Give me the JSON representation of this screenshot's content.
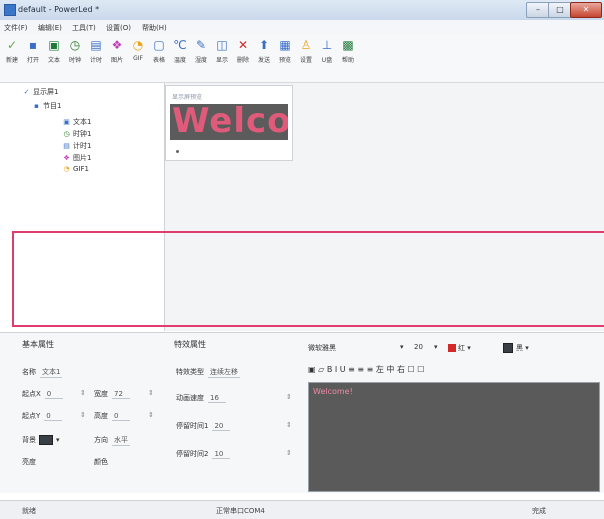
{
  "window": {
    "title": "default - PowerLed *"
  },
  "menubar": {
    "items": [
      "文件(F)",
      "编辑(E)",
      "工具(T)",
      "设置(O)",
      "帮助(H)"
    ]
  },
  "toolbar": {
    "buttons": [
      {
        "label": "新建",
        "icon": "new-icon",
        "glyph": "✓",
        "color": "#6aa84f"
      },
      {
        "label": "打开",
        "icon": "open-icon",
        "glyph": "▪",
        "color": "#3b6fc7"
      },
      {
        "label": "文本",
        "icon": "text-icon",
        "glyph": "▣",
        "color": "#1f7a3a"
      },
      {
        "label": "时钟",
        "icon": "clock-icon",
        "glyph": "◷",
        "color": "#2a7d2a"
      },
      {
        "label": "计时",
        "icon": "timer-icon",
        "glyph": "▤",
        "color": "#3b6fc7"
      },
      {
        "label": "图片",
        "icon": "image-icon",
        "glyph": "❖",
        "color": "#c03db8"
      },
      {
        "label": "GIF",
        "icon": "gif-icon",
        "glyph": "◔",
        "color": "#e8a317"
      },
      {
        "label": "表格",
        "icon": "table-icon",
        "glyph": "▢",
        "color": "#3b6fc7"
      },
      {
        "label": "温度",
        "icon": "temperature-icon",
        "glyph": "℃",
        "color": "#3b6fc7"
      },
      {
        "label": "湿度",
        "icon": "humidity-icon",
        "glyph": "✎",
        "color": "#3b6fc7"
      },
      {
        "label": "显示",
        "icon": "display-icon",
        "glyph": "◫",
        "color": "#3b6fc7"
      },
      {
        "label": "删除",
        "icon": "delete-icon",
        "glyph": "✕",
        "color": "#d22a2a"
      },
      {
        "label": "发送",
        "icon": "send-icon",
        "glyph": "⬆",
        "color": "#3b6fc7"
      },
      {
        "label": "预览",
        "icon": "preview-icon",
        "glyph": "▦",
        "color": "#3b6fc7"
      },
      {
        "label": "设置",
        "icon": "settings-icon",
        "glyph": "♙",
        "color": "#e8a317"
      },
      {
        "label": "U盘",
        "icon": "usb-icon",
        "glyph": "⊥",
        "color": "#3b6fc7"
      },
      {
        "label": "帮助",
        "icon": "help-icon",
        "glyph": "▩",
        "color": "#1f7a3a"
      }
    ]
  },
  "tree": {
    "nodes": [
      {
        "label": "显示屏1",
        "icon": "screen-icon",
        "glyph": "✓",
        "color": "#3b6fc7"
      },
      {
        "label": "节目1",
        "icon": "program-icon",
        "glyph": "▪",
        "color": "#3b6fc7"
      },
      {
        "label": "文本1",
        "icon": "text-icon",
        "glyph": "▣",
        "color": "#3b6fc7"
      },
      {
        "label": "时钟1",
        "icon": "clock-icon",
        "glyph": "◷",
        "color": "#2a7d2a"
      },
      {
        "label": "计时1",
        "icon": "timer-icon",
        "glyph": "▤",
        "color": "#3b6fc7"
      },
      {
        "label": "图片1",
        "icon": "image-icon",
        "glyph": "❖",
        "color": "#c03db8"
      },
      {
        "label": "GIF1",
        "icon": "gif-icon",
        "glyph": "◔",
        "color": "#e8a317"
      }
    ]
  },
  "preview": {
    "caption": "显示屏预览",
    "text": "Welcome!"
  },
  "props": {
    "basic_title": "基本属性",
    "effect_title": "特效属性",
    "name_label": "名称",
    "name_value": "文本1",
    "x_label": "起点X",
    "x_value": "0",
    "w_label": "宽度",
    "w_value": "72",
    "y_label": "起点Y",
    "y_value": "0",
    "h_label": "高度",
    "h_value": "0",
    "bg_label": "背景",
    "dir_label": "方向",
    "dir_value": "水平",
    "brightness_label": "亮度",
    "color_label": "颜色",
    "effect_label": "特效类型",
    "effect_value": "连续左移",
    "speed_label": "动画速度",
    "speed_value": "16",
    "stay_label": "停留时间1",
    "stay_value": "20",
    "stay2_label": "停留时间2",
    "stay2_value": "10"
  },
  "format": {
    "font": "微软雅黑",
    "size": "20",
    "fg_label": "红",
    "bg_label": "黑",
    "bar_text": "B I U ≡ ≡ ≡ 左 中 右 ☐ ☐"
  },
  "editor": {
    "text": "Welcome!"
  },
  "status": {
    "left": "就绪",
    "center": "正常串口COM4",
    "right": "完成"
  }
}
